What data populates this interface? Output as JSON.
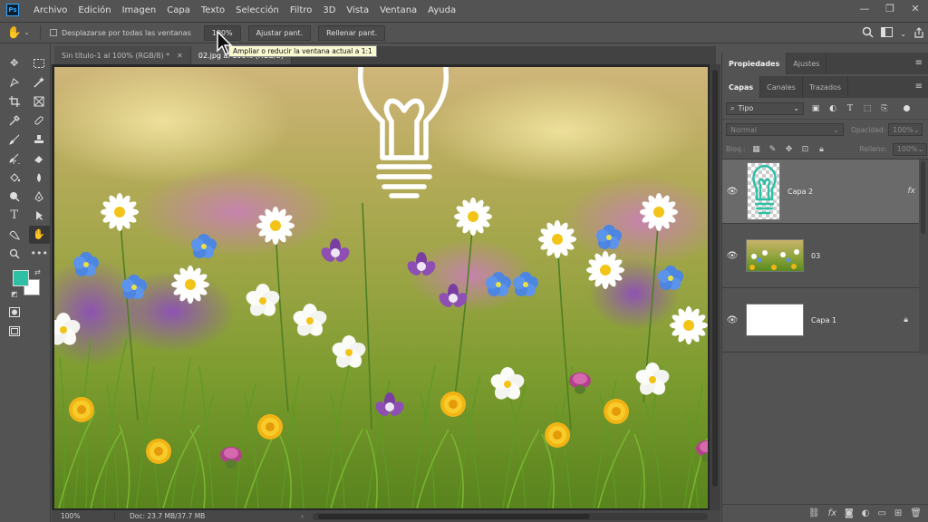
{
  "app": {
    "logo": "Ps"
  },
  "menu": [
    "Archivo",
    "Edición",
    "Imagen",
    "Capa",
    "Texto",
    "Selección",
    "Filtro",
    "3D",
    "Vista",
    "Ventana",
    "Ayuda"
  ],
  "window_controls": {
    "minimize": "—",
    "restore": "❐",
    "close": "✕"
  },
  "options": {
    "tool_icon": "hand-icon",
    "scroll_all_label": "Desplazarse por todas las ventanas",
    "btn_100": "100%",
    "btn_fit": "Ajustar pant.",
    "btn_fill": "Rellenar pant."
  },
  "tooltip": "Ampliar o reducir la ventana actual a 1:1",
  "doc_tabs": [
    {
      "label": "Sin título-1 al 100% (RGB/8) *",
      "close": "✕"
    },
    {
      "label": "02.jpg al 100% (RGB/8)",
      "close": ""
    }
  ],
  "status": {
    "zoom": "100%",
    "doc": "Doc: 23.7 MB/37.7 MB",
    "arrow": "›"
  },
  "panels": {
    "top_tabs": [
      "Propiedades",
      "Ajustes"
    ],
    "layer_tabs": [
      "Capas",
      "Canales",
      "Trazados"
    ],
    "filter_kind": "Tipo",
    "blend_mode": "Normal",
    "opacity_label": "Opacidad:",
    "opacity_value": "100%",
    "lock_label": "Bloq.:",
    "fill_label": "Relleno:",
    "fill_value": "100%",
    "menu_icon": "≡"
  },
  "layers": [
    {
      "name": "Capa 2",
      "fx": "fx",
      "selected": true
    },
    {
      "name": "03",
      "fx": "",
      "selected": false
    },
    {
      "name": "Capa 1",
      "fx": "",
      "selected": false
    }
  ],
  "colors": {
    "foreground": "#2ebfa5",
    "background": "#ffffff",
    "accent": "#31a8ff"
  }
}
